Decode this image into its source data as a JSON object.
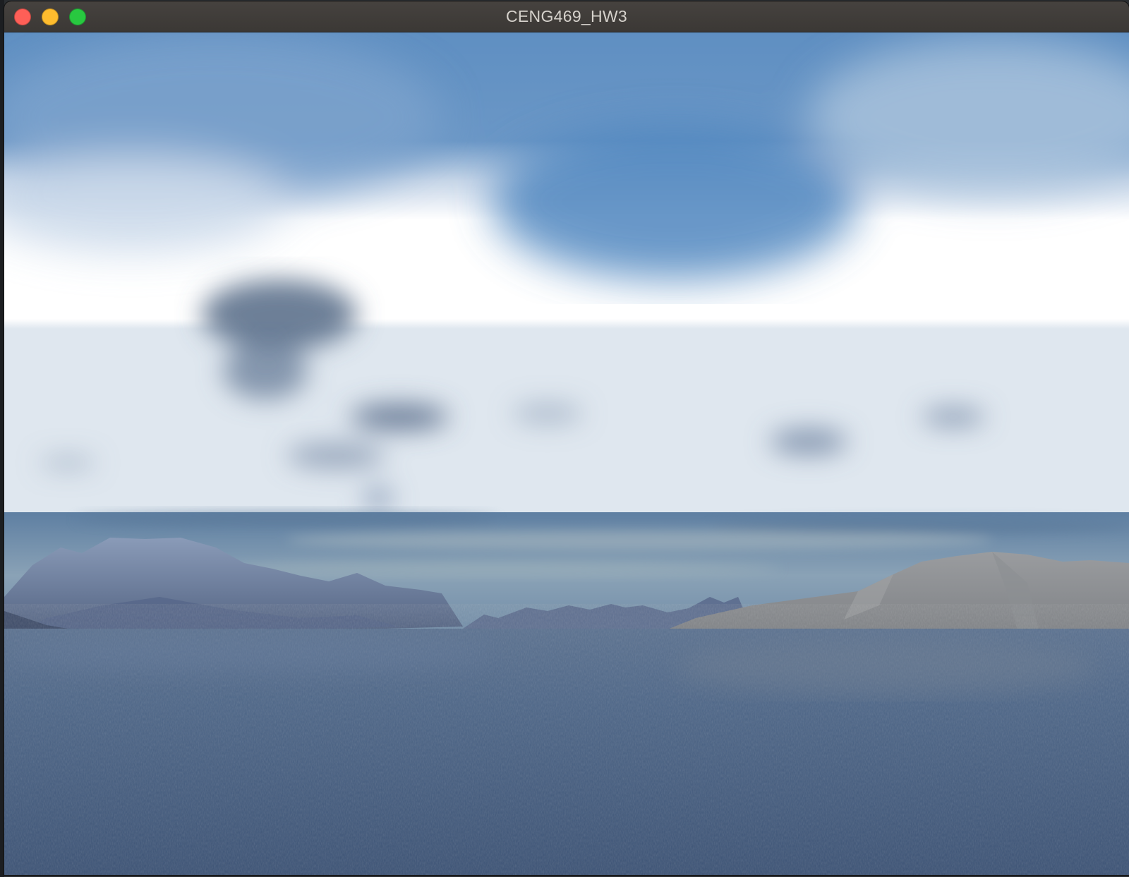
{
  "window": {
    "title": "CENG469_HW3"
  },
  "icons": {
    "close": "close-button-icon",
    "minimize": "minimize-button-icon",
    "zoom": "zoom-button-icon"
  },
  "colors": {
    "close": "#fe5f57",
    "minimize": "#febc2e",
    "zoom": "#28c840",
    "sky_top": "#5e8fc4",
    "cloud": "#ffffff",
    "mountain": "#6f7f9a",
    "water": "#41587a"
  },
  "scene": {
    "description_kind": "rendered-skybox-with-water"
  }
}
